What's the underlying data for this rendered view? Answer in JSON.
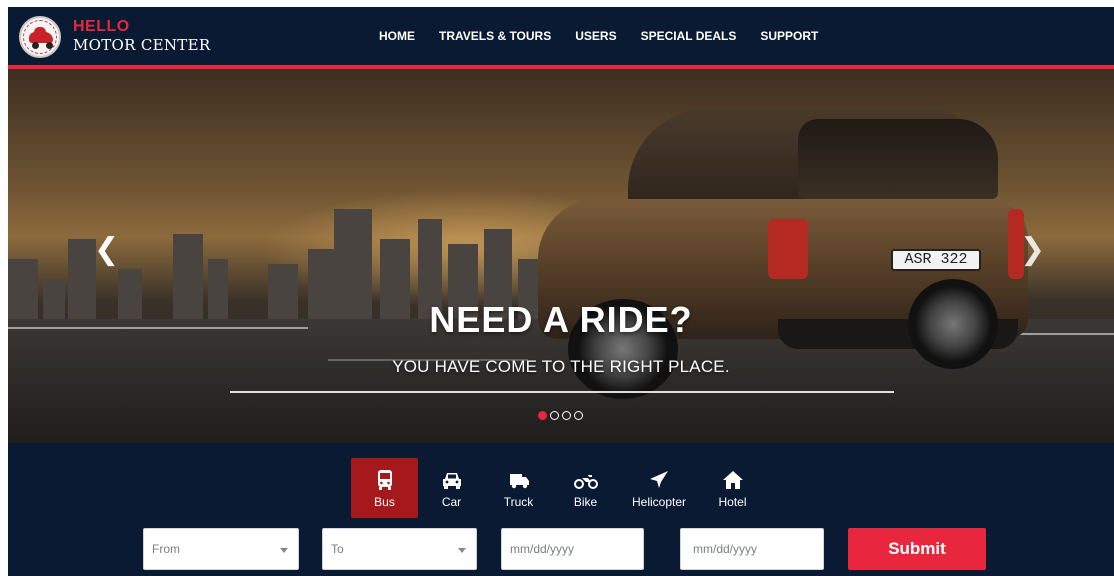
{
  "brand": {
    "title": "HELLO",
    "subtitle": "MOTOR CENTER",
    "accent_color": "#e8273e"
  },
  "nav": {
    "items": [
      "HOME",
      "TRAVELS & TOURS",
      "USERS",
      "SPECIAL DEALS",
      "SUPPORT"
    ]
  },
  "hero": {
    "title": "NEED A RIDE?",
    "subtitle": "YOU HAVE COME TO THE RIGHT PLACE.",
    "plate_text": "ASR 322",
    "slides_total": 4,
    "active_slide": 1
  },
  "search": {
    "tabs": [
      {
        "label": "Bus",
        "icon": "bus-icon",
        "active": true
      },
      {
        "label": "Car",
        "icon": "car-icon",
        "active": false
      },
      {
        "label": "Truck",
        "icon": "truck-icon",
        "active": false
      },
      {
        "label": "Bike",
        "icon": "motorcycle-icon",
        "active": false
      },
      {
        "label": "Helicopter",
        "icon": "plane-icon",
        "active": false
      },
      {
        "label": "Hotel",
        "icon": "home-icon",
        "active": false
      }
    ],
    "from_placeholder": "From",
    "to_placeholder": "To",
    "date1_placeholder": "mm/dd/yyyy",
    "date2_placeholder": "mm/dd/yyyy",
    "submit_label": "Submit",
    "active_tab_color": "#a5191d",
    "background_color": "#0b1a33"
  }
}
